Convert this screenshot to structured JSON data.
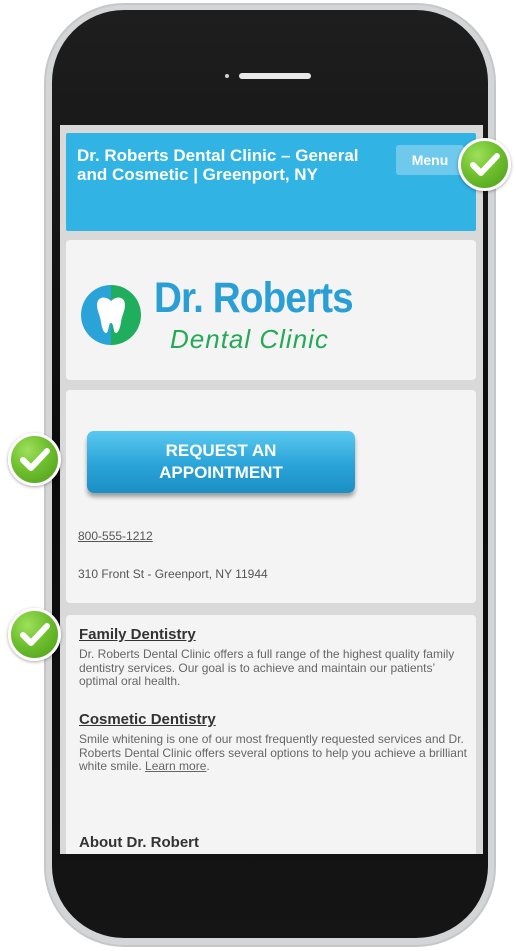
{
  "header": {
    "title": "Dr. Roberts Dental Clinic – General and Cosmetic | Greenport, NY",
    "menu_label": "Menu",
    "color": "#31b4e4"
  },
  "logo": {
    "name": "Dr. Roberts",
    "subtitle": "Dental Clinic",
    "icon": "tooth-icon"
  },
  "contact": {
    "cta_line1": "REQUEST AN",
    "cta_line2": "APPOINTMENT",
    "phone": "800-555-1212",
    "address": "310 Front St - Greenport, NY 11944"
  },
  "services": [
    {
      "heading": "Family Dentistry",
      "text": "Dr. Roberts Dental Clinic offers a full range of the highest quality family dentistry services. Our goal is to achieve and maintain our patients’ optimal oral health."
    },
    {
      "heading": "Cosmetic Dentistry",
      "text": "Smile whitening is one of our most frequently requested services and Dr. Roberts Dental Clinic offers several options to help you achieve a brilliant white smile.",
      "link": "Learn more"
    }
  ],
  "about_heading": "About Dr. Robert",
  "annotations": {
    "icon": "checkmark-icon",
    "color": "#6fc02e"
  }
}
